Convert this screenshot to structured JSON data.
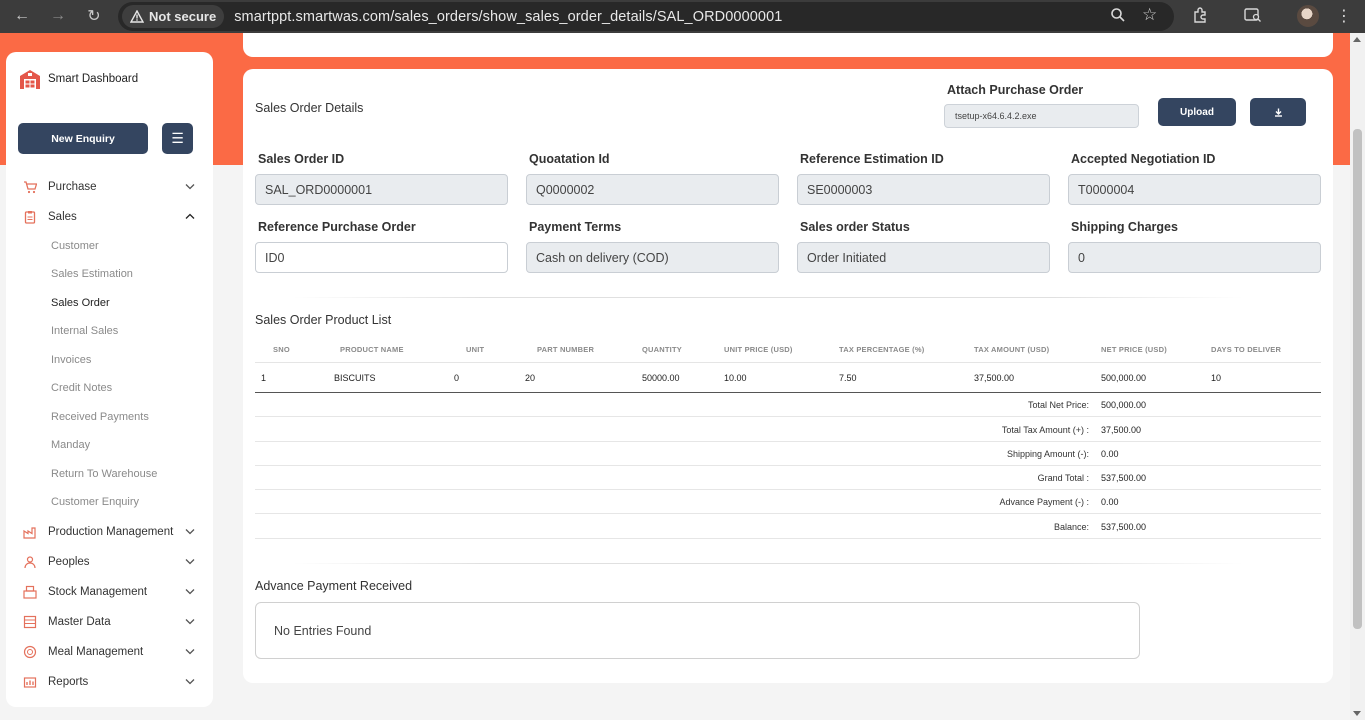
{
  "browser": {
    "security_label": "Not secure",
    "url": "smartppt.smartwas.com/sales_orders/show_sales_order_details/SAL_ORD0000001"
  },
  "sidebar": {
    "brand": "Smart Dashboard",
    "new_enquiry_label": "New Enquiry",
    "items": [
      {
        "label": "Purchase",
        "icon": "cart-icon"
      },
      {
        "label": "Sales",
        "icon": "clipboard-icon"
      },
      {
        "label": "Production Management",
        "icon": "factory-icon"
      },
      {
        "label": "Peoples",
        "icon": "people-icon"
      },
      {
        "label": "Stock Management",
        "icon": "boxes-icon"
      },
      {
        "label": "Master Data",
        "icon": "database-icon"
      },
      {
        "label": "Meal Management",
        "icon": "meal-icon"
      },
      {
        "label": "Reports",
        "icon": "report-icon"
      }
    ],
    "sales_sub": [
      "Customer",
      "Sales Estimation",
      "Sales Order",
      "Internal Sales",
      "Invoices",
      "Credit Notes",
      "Received Payments",
      "Manday",
      "Return To Warehouse",
      "Customer Enquiry"
    ],
    "active_sub": "Sales Order"
  },
  "details": {
    "title": "Sales Order Details",
    "attach_label": "Attach Purchase Order",
    "attach_file": "tsetup-x64.6.4.2.exe",
    "upload_label": "Upload",
    "fields": {
      "sales_order_id": {
        "label": "Sales Order ID",
        "value": "SAL_ORD0000001"
      },
      "quotation_id": {
        "label": "Quoatation Id",
        "value": "Q0000002"
      },
      "ref_estimation_id": {
        "label": "Reference Estimation ID",
        "value": "SE0000003"
      },
      "accepted_negotiation_id": {
        "label": "Accepted Negotiation ID",
        "value": "T0000004"
      },
      "ref_purchase_order": {
        "label": "Reference Purchase Order",
        "value": "ID0"
      },
      "payment_terms": {
        "label": "Payment Terms",
        "value": "Cash on delivery (COD)"
      },
      "status": {
        "label": "Sales order Status",
        "value": "Order Initiated"
      },
      "shipping_charges": {
        "label": "Shipping Charges",
        "value": "0"
      }
    }
  },
  "products": {
    "title": "Sales Order Product List",
    "columns": [
      "SNO",
      "PRODUCT NAME",
      "UNIT",
      "PART NUMBER",
      "QUANTITY",
      "UNIT PRICE (USD)",
      "TAX PERCENTAGE (%)",
      "TAX AMOUNT (USD)",
      "NET PRICE (USD)",
      "DAYS TO DELIVER"
    ],
    "rows": [
      [
        "1",
        "BISCUITS",
        "0",
        "20",
        "50000.00",
        "10.00",
        "7.50",
        "37,500.00",
        "500,000.00",
        "10"
      ]
    ],
    "summary": [
      {
        "label": "Total Net Price:",
        "value": "500,000.00"
      },
      {
        "label": "Total Tax Amount (+) :",
        "value": "37,500.00"
      },
      {
        "label": "Shipping Amount (-):",
        "value": "0.00"
      },
      {
        "label": "Grand Total :",
        "value": "537,500.00"
      },
      {
        "label": "Advance Payment (-) :",
        "value": "0.00"
      },
      {
        "label": "Balance:",
        "value": "537,500.00"
      }
    ]
  },
  "advance": {
    "title": "Advance Payment Received",
    "empty_text": "No Entries Found"
  },
  "colors": {
    "accent_orange": "#fb6a45",
    "button_navy": "#344560"
  }
}
